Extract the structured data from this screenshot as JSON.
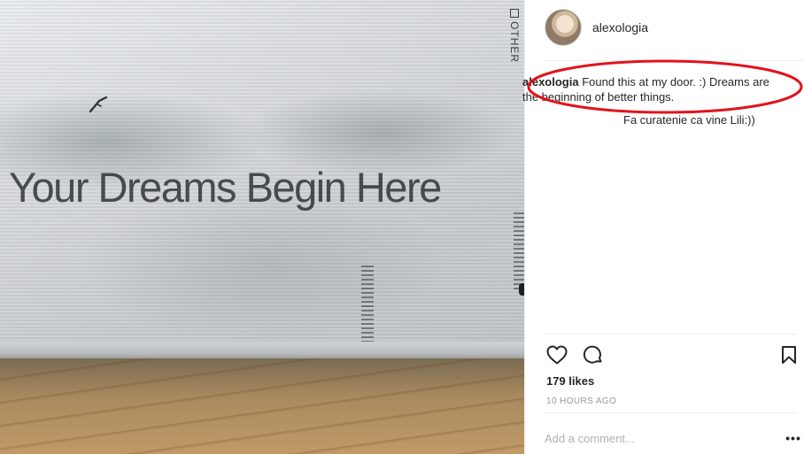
{
  "photo": {
    "headline": "Your Dreams Begin Here",
    "side_label": "OTHER"
  },
  "post": {
    "username": "alexologia",
    "caption": {
      "user": "alexologia",
      "text": " Found this at my door. :) Dreams are the beginning of better things."
    },
    "reply_text": "Fa curatenie ca vine Lili:))",
    "likes_text": "179 likes",
    "timestamp": "10 HOURS AGO",
    "add_comment_placeholder": "Add a comment...",
    "more_options": "•••"
  },
  "icons": {
    "like": "heart-icon",
    "comment": "speech-bubble-icon",
    "save": "bookmark-icon",
    "more": "more-options-icon"
  },
  "colors": {
    "annotation_circle": "#e0141e",
    "text_primary": "#262626",
    "text_muted": "#999999"
  }
}
